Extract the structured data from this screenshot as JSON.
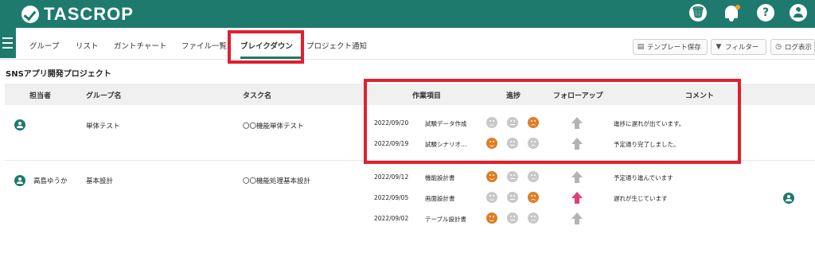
{
  "app": {
    "name": "TASCROP"
  },
  "header_icons": [
    "trash-icon",
    "bell-icon",
    "help-icon",
    "user-icon"
  ],
  "tabs": [
    {
      "label": "グループ"
    },
    {
      "label": "リスト"
    },
    {
      "label": "ガントチャート"
    },
    {
      "label": "ファイル一覧"
    },
    {
      "label": "ブレイクダウン",
      "active": true
    },
    {
      "label": "プロジェクト通知"
    }
  ],
  "toolbar": {
    "template_label": "テンプレート保存",
    "filter_label": "フィルター",
    "log_label": "ログ表示"
  },
  "project": {
    "title": "SNSアプリ開発プロジェクト"
  },
  "columns": {
    "assignee": "担当者",
    "group": "グループ名",
    "task": "タスク名",
    "work_item": "作業項目",
    "progress": "進捗",
    "followup": "フォローアップ",
    "comment": "コメント"
  },
  "groups": [
    {
      "assignee": "",
      "group": "単体テスト",
      "task": "〇〇機能単体テスト",
      "items": [
        {
          "date": "2022/09/20",
          "name": "試験データ作成",
          "progress": "sad",
          "followup": "gray",
          "comment": "進捗に遅れが出ています。"
        },
        {
          "date": "2022/09/19",
          "name": "試験シナリオ…",
          "progress": "happy",
          "followup": "gray",
          "comment": "予定通り完了しました。"
        }
      ]
    },
    {
      "assignee": "高島ゆうか",
      "group": "基本設計",
      "task": "〇〇機能処理基本設計",
      "items": [
        {
          "date": "2022/09/12",
          "name": "機能設計書",
          "progress": "happy",
          "followup": "gray",
          "comment": "予定通り進んでいます"
        },
        {
          "date": "2022/09/05",
          "name": "画面設計書",
          "progress": "sad",
          "followup": "pink",
          "comment": "遅れが生じています"
        },
        {
          "date": "2022/09/02",
          "name": "テーブル設計書",
          "progress": "happy",
          "followup": "gray",
          "comment": ""
        }
      ]
    }
  ],
  "colors": {
    "brand": "#1f7a6e",
    "highlight": "#e0202e",
    "progress_on": "#e07d24",
    "progress_off": "#c8c8c8",
    "followup_alert": "#e0407a"
  }
}
